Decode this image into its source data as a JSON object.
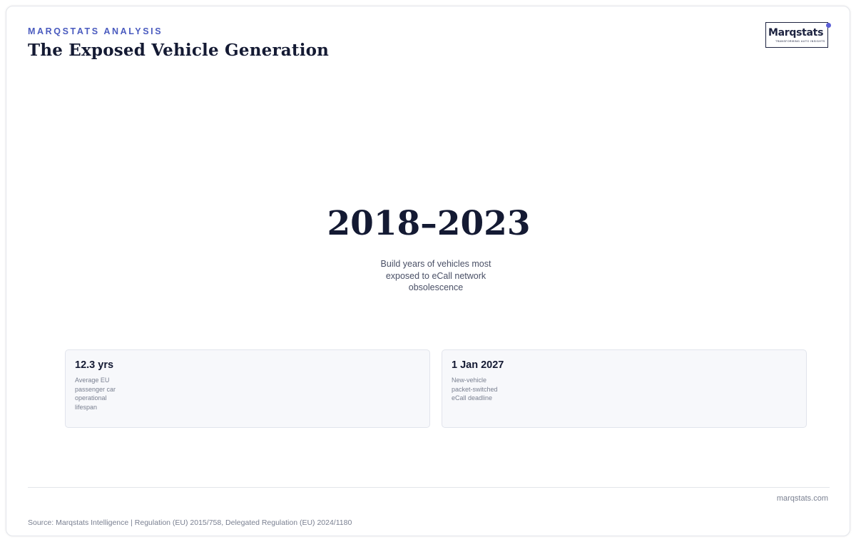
{
  "header": {
    "eyebrow": "MARQSTATS ANALYSIS",
    "title": "The Exposed Vehicle Generation"
  },
  "logo": {
    "wordmark": "Marqstats",
    "tagline": "TRANSFORMING AUTO INSIGHTS",
    "accent_color": "#5b5fd6"
  },
  "hero": {
    "value": "2018–2023",
    "caption": "Build years of vehicles most exposed to eCall network obsolescence"
  },
  "stats": [
    {
      "value": "12.3 yrs",
      "label": "Average EU passenger car operational lifespan"
    },
    {
      "value": "1 Jan 2027",
      "label": "New-vehicle packet-switched eCall deadline"
    }
  ],
  "footer": {
    "site": "marqstats.com",
    "source": "Source: Marqstats Intelligence | Regulation (EU) 2015/758, Delegated Regulation (EU) 2024/1180"
  },
  "colors": {
    "accent": "#4a5bbf",
    "ink": "#141a33"
  }
}
